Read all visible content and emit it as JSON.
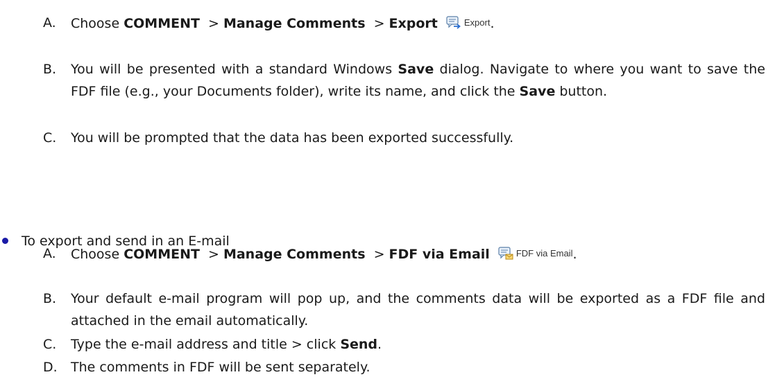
{
  "steps_export": [
    {
      "letter": "A.",
      "choose": "Choose",
      "menu": "COMMENT",
      "sep1": ">",
      "group": "Manage Comments",
      "sep2": ">",
      "command": "Export",
      "button_label": "Export",
      "button_icon": "export-comment-icon",
      "end": "."
    },
    {
      "letter": "B.",
      "t1": "You will be presented with a standard Windows ",
      "b1": "Save",
      "t2": " dialog. Navigate to where you want to save the FDF file (e.g., your Documents folder), write its name, and click the ",
      "b2": "Save",
      "t3": " button."
    },
    {
      "letter": "C.",
      "text": "You will be prompted that the data has been exported successfully."
    }
  ],
  "bullet": {
    "text": "To export and send in an E-mail"
  },
  "steps_email": [
    {
      "letter": "A.",
      "choose": "Choose",
      "menu": "COMMENT",
      "sep1": ">",
      "group": "Manage Comments",
      "sep2": ">",
      "command": "FDF via Email",
      "button_label": "FDF via Email",
      "button_icon": "fdf-via-email-icon",
      "end": "."
    },
    {
      "letter": "B.",
      "text": "Your default e-mail program will pop up, and the comments data will be exported as a FDF file and attached in the email automatically."
    },
    {
      "letter": "C.",
      "t1": "Type the e-mail address and title > click ",
      "b1": "Send",
      "t2": "."
    },
    {
      "letter": "D.",
      "text": "The comments in FDF will be sent separately."
    }
  ]
}
